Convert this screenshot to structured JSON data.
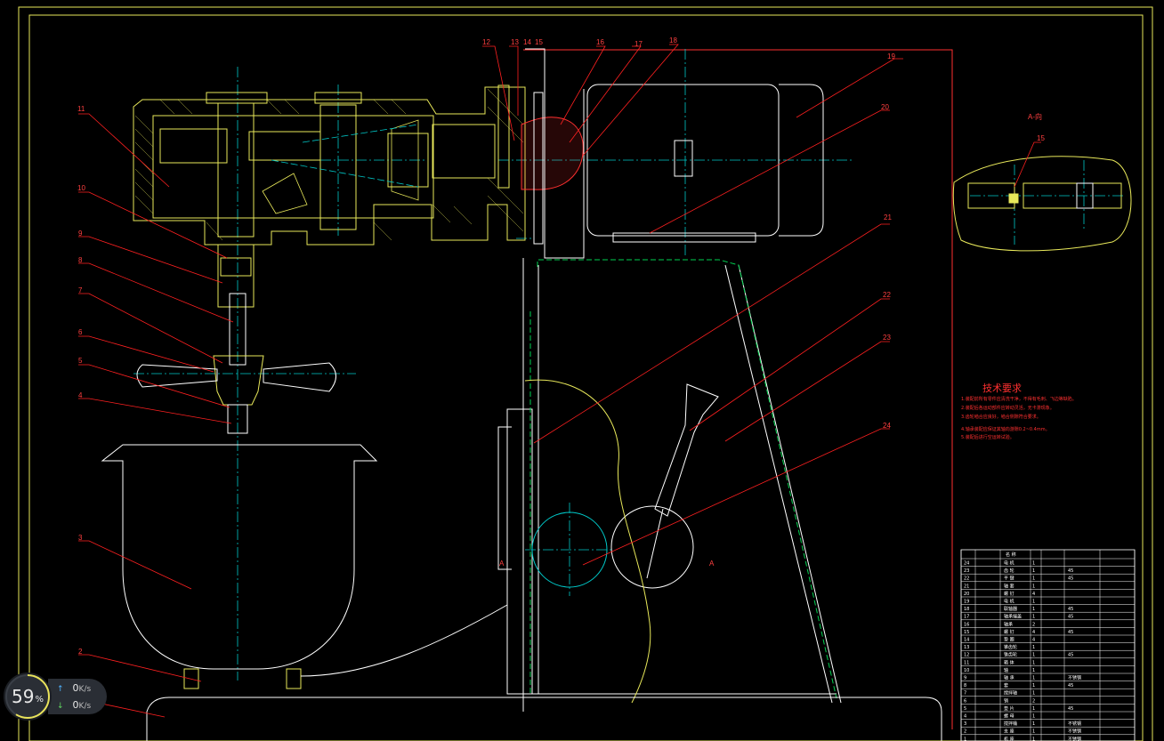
{
  "drawing": {
    "view_label": "A-向",
    "section_marks": [
      "A",
      "A"
    ],
    "part_callouts": [
      "1",
      "2",
      "3",
      "4",
      "5",
      "6",
      "7",
      "8",
      "9",
      "10",
      "11",
      "12",
      "13",
      "14",
      "15",
      "16",
      "17",
      "18",
      "19",
      "20",
      "21",
      "22",
      "23",
      "24"
    ],
    "view_detail_callout": "15",
    "requirements_title": "技术要求",
    "requirements_lines": [
      "1.装配前所有零件应清洗干净，不得有毛刺、飞边等缺陷。",
      "2.装配后各运动部件应转动灵活，无卡滞现象。",
      "3.齿轮啮合应良好，啮合侧隙符合要求。",
      "4.轴承装配应保证其轴向游隙0.2~0.4mm。",
      "5.装配后进行空运转试验。"
    ],
    "table_header": "名 称",
    "table_rows": [
      [
        "24",
        "",
        "电 机",
        "1",
        ""
      ],
      [
        "23",
        "",
        "齿 轮",
        "1",
        "45"
      ],
      [
        "22",
        "",
        "平 键",
        "1",
        "45"
      ],
      [
        "21",
        "",
        "轴 套",
        "1",
        ""
      ],
      [
        "20",
        "",
        "螺 钉",
        "4",
        ""
      ],
      [
        "19",
        "",
        "电 机",
        "1",
        ""
      ],
      [
        "18",
        "",
        "联轴器",
        "1",
        "45"
      ],
      [
        "17",
        "",
        "轴承端盖",
        "1",
        "45"
      ],
      [
        "16",
        "",
        "轴承",
        "2",
        ""
      ],
      [
        "15",
        "",
        "螺 钉",
        "4",
        "45"
      ],
      [
        "14",
        "",
        "垫 圈",
        "4",
        ""
      ],
      [
        "13",
        "",
        "锥齿轮",
        "1",
        ""
      ],
      [
        "12",
        "",
        "锥齿轮",
        "1",
        "45"
      ],
      [
        "11",
        "",
        "箱 体",
        "1",
        ""
      ],
      [
        "10",
        "",
        "轴",
        "1",
        ""
      ],
      [
        "9",
        "",
        "轴 承",
        "1",
        "不锈钢"
      ],
      [
        "8",
        "",
        "套",
        "1",
        "45"
      ],
      [
        "7",
        "",
        "搅拌轴",
        "1",
        ""
      ],
      [
        "6",
        "",
        "销",
        "2",
        ""
      ],
      [
        "5",
        "",
        "垫 片",
        "1",
        "45"
      ],
      [
        "4",
        "",
        "螺 母",
        "1",
        ""
      ],
      [
        "3",
        "",
        "搅拌桶",
        "1",
        "不锈钢"
      ],
      [
        "2",
        "",
        "支 座",
        "1",
        "不锈钢"
      ],
      [
        "1",
        "",
        "机 座",
        "1",
        "不锈钢"
      ]
    ]
  },
  "net_monitor": {
    "percent": "59",
    "percent_sign": "%",
    "upload_value": "0",
    "download_value": "0",
    "unit": "K/s",
    "ring_fraction": 0.59,
    "ring_color": "#e8e25a"
  }
}
